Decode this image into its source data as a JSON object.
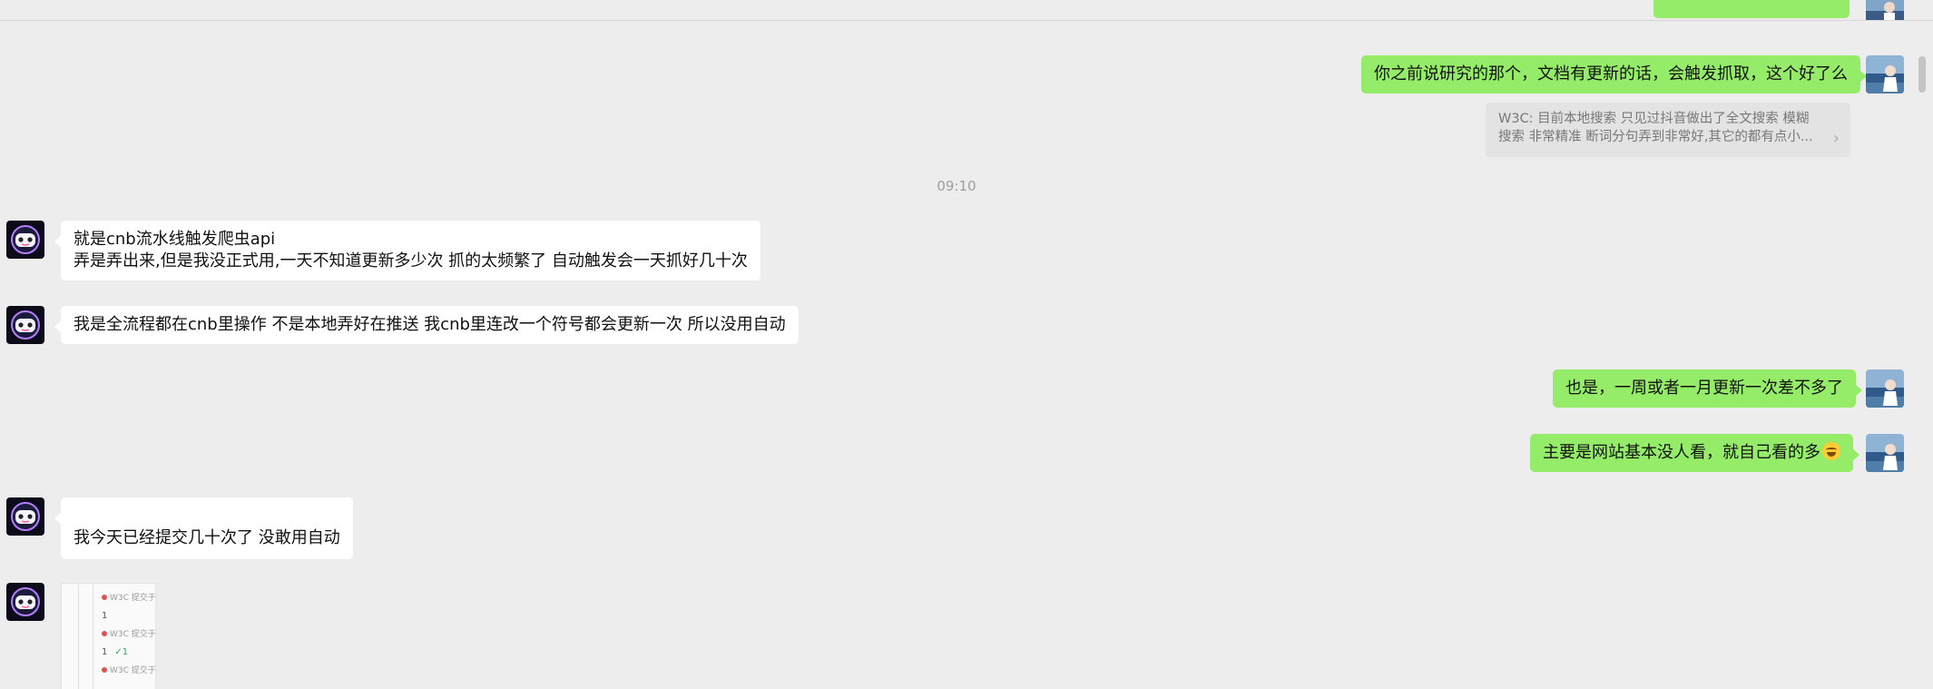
{
  "colors": {
    "background": "#ededed",
    "bubble_in": "#ffffff",
    "bubble_out": "#95ec69",
    "quote_bg": "#e3e3e3",
    "timestamp": "#9d9d9d"
  },
  "messages": {
    "m1": {
      "text": "你之前说研究的那个，文档有更新的话，会触发抓取，这个好了么"
    },
    "quote": {
      "line1": "W3C: 目前本地搜索 只见过抖音做出了全文搜索 模糊",
      "line2": "搜索 非常精准 断词分句弄到非常好,其它的都有点小..."
    },
    "timestamp": "09:10",
    "m2": {
      "line1": "就是cnb流水线触发爬虫api",
      "line2": "弄是弄出来,但是我没正式用,一天不知道更新多少次 抓的太频繁了 自动触发会一天抓好几十次"
    },
    "m3": {
      "text": "我是全流程都在cnb里操作 不是本地弄好在推送 我cnb里连改一个符号都会更新一次 所以没用自动"
    },
    "m4": {
      "text": "也是，一周或者一月更新一次差不多了"
    },
    "m5": {
      "text": "主要是网站基本没人看，就自己看的多",
      "emoji": "joy-emoji"
    },
    "m6": {
      "text": "我今天已经提交几十次了 没敢用自动"
    },
    "image_msg": {
      "rows": [
        "W3C 提交于",
        "1",
        "W3C 提交于",
        "1",
        "✓1",
        "W3C 提交于"
      ]
    }
  }
}
